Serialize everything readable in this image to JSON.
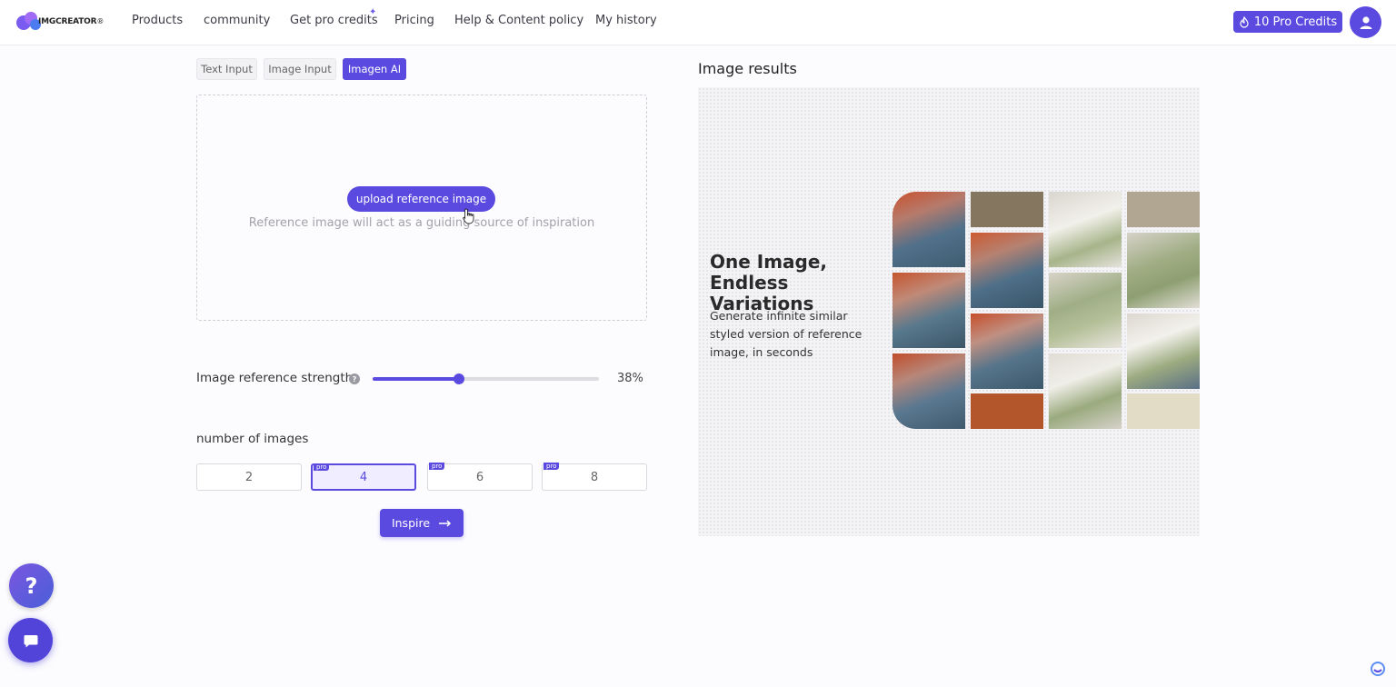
{
  "header": {
    "logo_text": "IMGCREATOR",
    "logo_mark": "®",
    "nav": [
      {
        "label": "Products"
      },
      {
        "label": "community"
      },
      {
        "label": "Get pro credits"
      },
      {
        "label": "Pricing"
      },
      {
        "label": "Help & Content policy"
      },
      {
        "label": "My history"
      }
    ],
    "credits_label": "10 Pro Credits"
  },
  "mode_tabs": [
    {
      "label": "Text Input",
      "active": false
    },
    {
      "label": "Image Input",
      "active": false
    },
    {
      "label": "Imagen AI",
      "active": true
    }
  ],
  "upload": {
    "button_label": "upload reference image",
    "hint": "Reference image will act as a guiding source of inspiration"
  },
  "strength": {
    "label": "Image reference strength",
    "help_icon": "?",
    "value": 38,
    "value_label": "38%"
  },
  "count": {
    "label": "number of images",
    "options": [
      {
        "label": "2",
        "pro": false,
        "selected": false
      },
      {
        "label": "4",
        "pro": true,
        "selected": true
      },
      {
        "label": "6",
        "pro": true,
        "selected": false
      },
      {
        "label": "8",
        "pro": true,
        "selected": false
      }
    ],
    "pro_badge": "pro"
  },
  "inspire": {
    "label": "Inspire",
    "icon": "arrow-right-icon"
  },
  "results": {
    "title": "Image results",
    "promo_title": "One Image, Endless Variations",
    "promo_subtitle": "Generate infinite similar styled version of reference image, in seconds"
  },
  "fabs": {
    "help": "?",
    "chat_icon": "chat-bubble-icon"
  },
  "colors": {
    "accent": "#5b4ae0",
    "accent_light": "#efedff"
  }
}
